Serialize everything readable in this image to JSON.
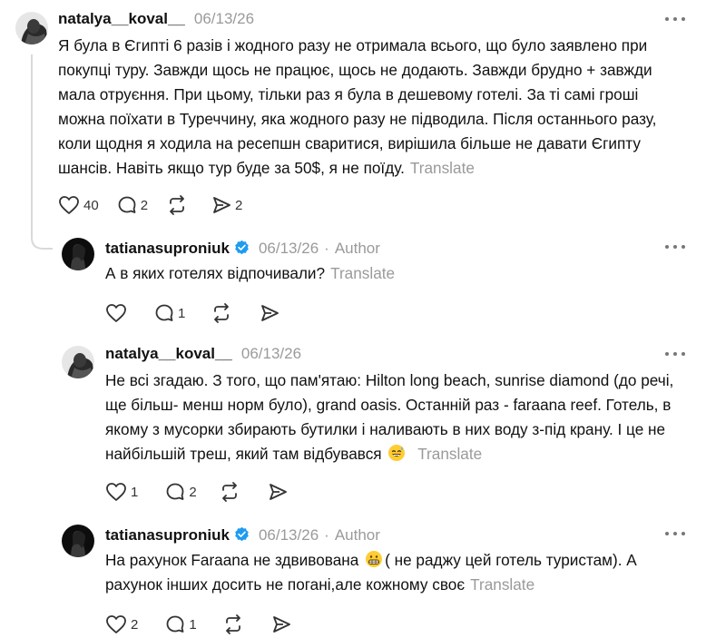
{
  "posts": [
    {
      "username": "natalya__koval__",
      "date": "06/13/26",
      "text": "Я була в Єгипті 6 разів і жодного разу не отримала всього, що було заявлено при покупці туру. Завжди щось не працює, щось не додають. Завжди брудно + завжди мала отруєння. При цьому, тільки раз я була в дешевому готелі. За ті самі гроші можна поїхати в Туреччину, яка жодного разу не підводила. Після останнього разу, коли щодня я ходила на ресепшн сваритися, вирішила більше не давати Єгипту шансів. Навіть якщо тур буде за 50$, я не поїду.",
      "translate": "Translate",
      "likes": "40",
      "replies": "2",
      "shares": "2"
    },
    {
      "username": "tatianasuproniuk",
      "date": "06/13/26",
      "separator": "·",
      "author_label": "Author",
      "text": "А в яких готелях відпочивали?",
      "translate": "Translate",
      "replies": "1"
    },
    {
      "username": "natalya__koval__",
      "date": "06/13/26",
      "text": "Не всі згадаю. З того, що пам'ятаю: Hilton long beach, sunrise diamond (до речі, ще більш- менш норм було), grand oasis. Останній раз - faraana reef. Готель, в якому з мусорки збирають бутилки і наливають в них воду з-під крану. І це не найбільшій треш, який там відбувався",
      "emoji": "sweat-smile",
      "translate": "Translate",
      "likes": "1",
      "replies": "2"
    },
    {
      "username": "tatianasuproniuk",
      "date": "06/13/26",
      "separator": "·",
      "author_label": "Author",
      "text_before": "На рахунок Faraana не здвивована",
      "emoji": "grimace",
      "text_after": "( не раджу цей готель туристам). А рахунок інших досить не погані,але кожному своє",
      "translate": "Translate",
      "likes": "2",
      "replies": "1"
    }
  ],
  "colors": {
    "muted": "#9a9a9a",
    "text": "#111111",
    "verified": "#1d9bf0",
    "thread_line": "#d9d9d9"
  },
  "icons": [
    "heart-icon",
    "reply-icon",
    "repost-icon",
    "share-icon",
    "more-icon",
    "verified-icon"
  ]
}
